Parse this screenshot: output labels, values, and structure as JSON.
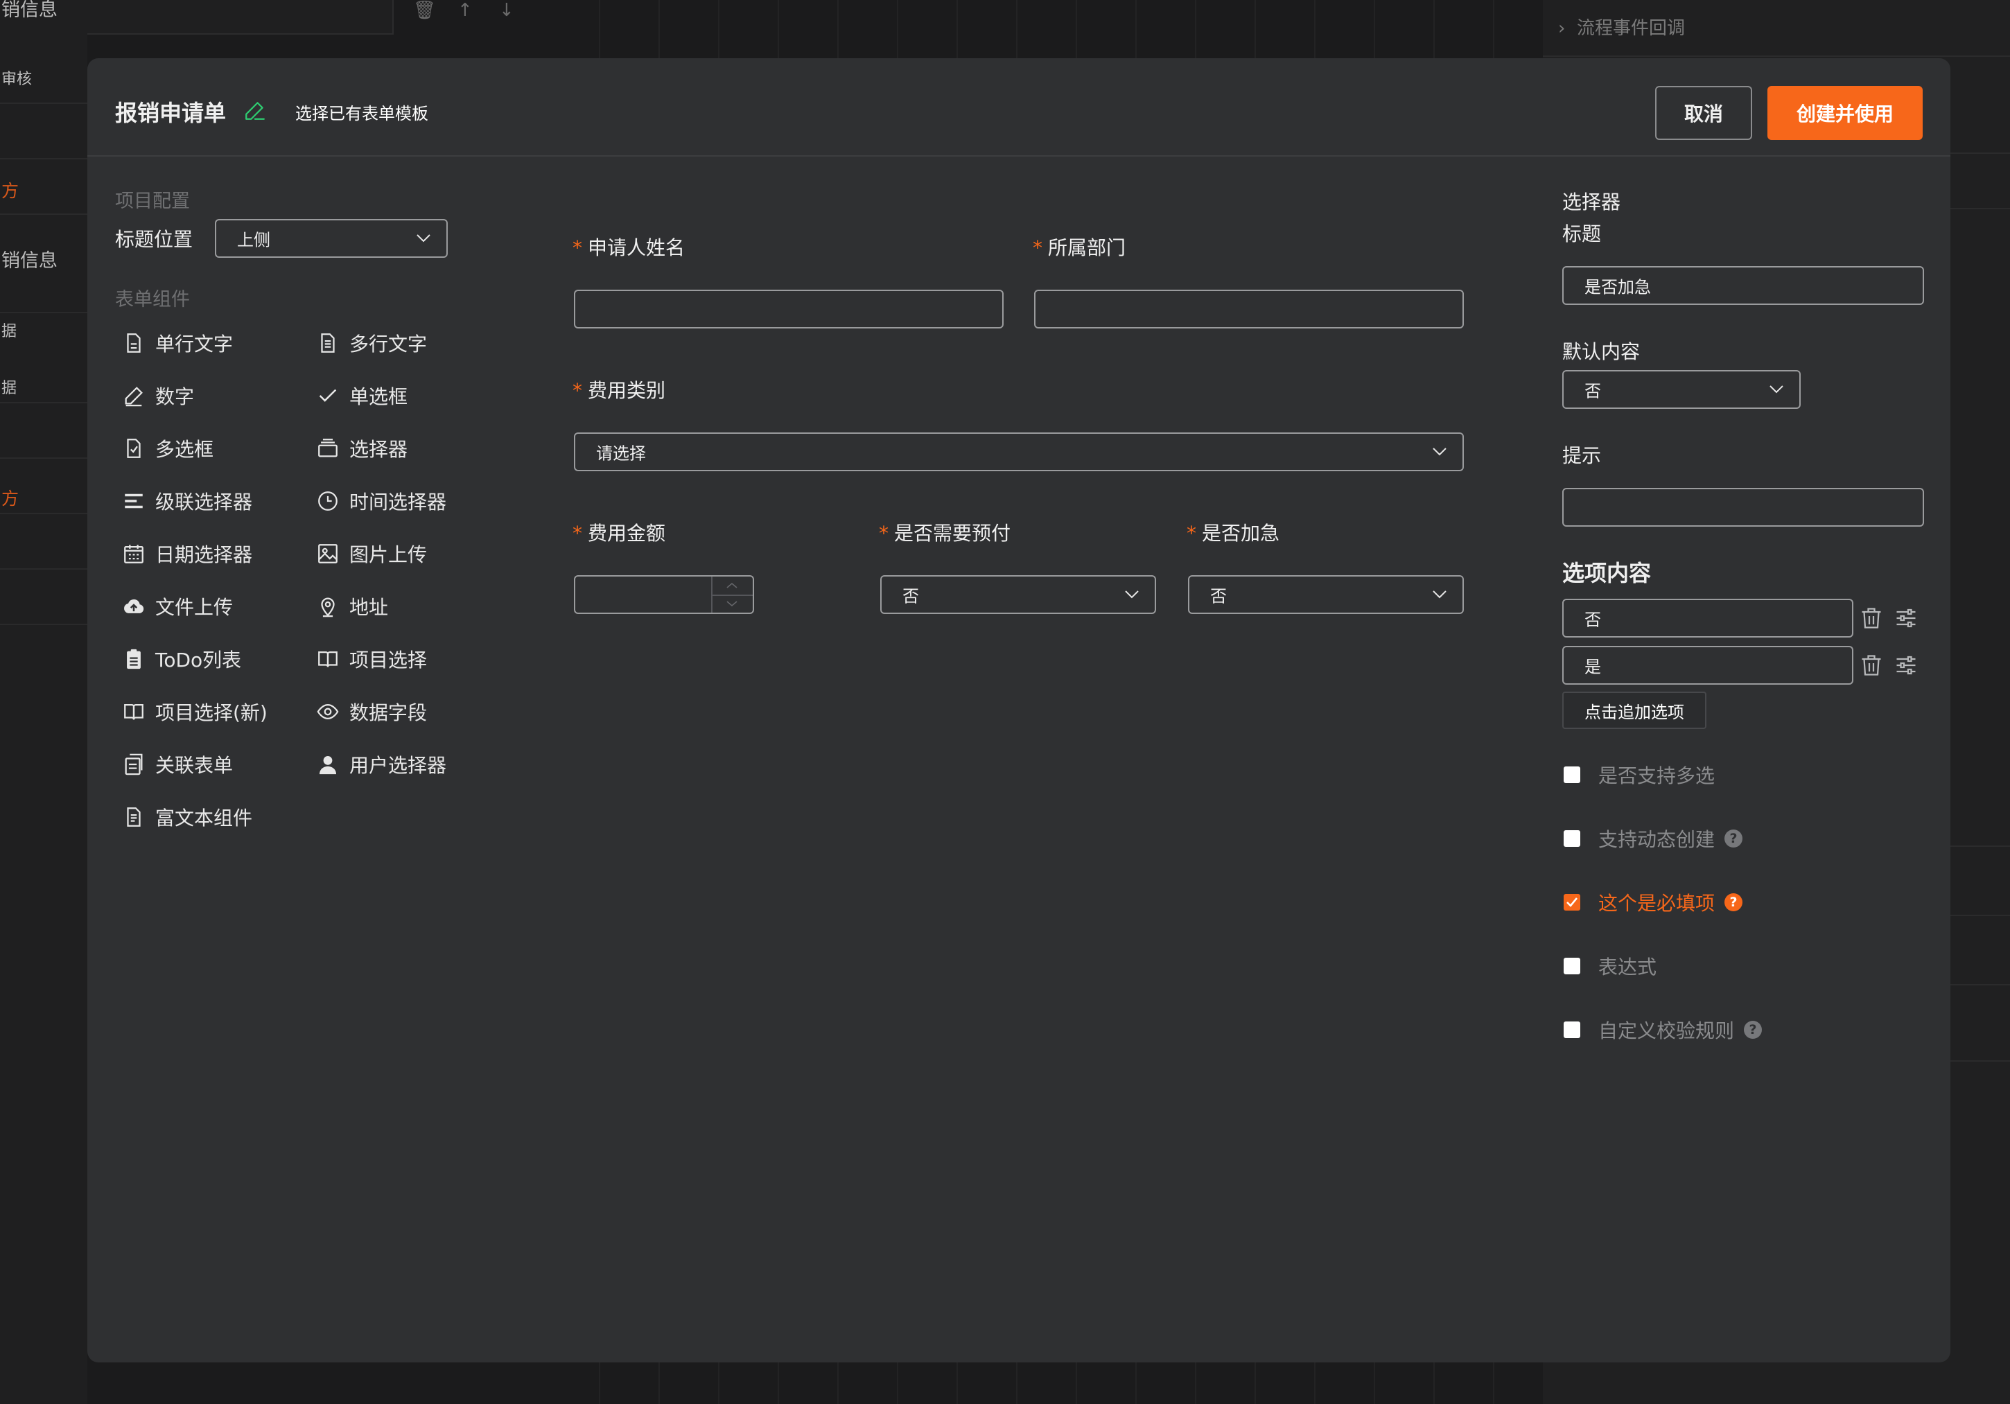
{
  "background": {
    "left_items": [
      "销信息",
      "审核",
      "方",
      "销信息",
      "据",
      "据",
      "方"
    ],
    "right_title": "流程事件回调"
  },
  "modal": {
    "title": "报销申请单",
    "template_link": "选择已有表单模板",
    "cancel_label": "取消",
    "create_label": "创建并使用"
  },
  "palette": {
    "config_section": "项目配置",
    "title_position_label": "标题位置",
    "title_position_value": "上侧",
    "components_section": "表单组件",
    "components": [
      {
        "label": "单行文字",
        "icon": "file-text-icon"
      },
      {
        "label": "多行文字",
        "icon": "file-lines-icon"
      },
      {
        "label": "数字",
        "icon": "pencil-icon"
      },
      {
        "label": "单选框",
        "icon": "check-icon"
      },
      {
        "label": "多选框",
        "icon": "checkbox-icon"
      },
      {
        "label": "选择器",
        "icon": "layers-icon"
      },
      {
        "label": "级联选择器",
        "icon": "list-icon"
      },
      {
        "label": "时间选择器",
        "icon": "clock-icon"
      },
      {
        "label": "日期选择器",
        "icon": "calendar-icon"
      },
      {
        "label": "图片上传",
        "icon": "image-icon"
      },
      {
        "label": "文件上传",
        "icon": "cloud-upload-icon"
      },
      {
        "label": "地址",
        "icon": "location-icon"
      },
      {
        "label": "ToDo列表",
        "icon": "clipboard-icon"
      },
      {
        "label": "项目选择",
        "icon": "book-icon"
      },
      {
        "label": "项目选择(新)",
        "icon": "book-icon"
      },
      {
        "label": "数据字段",
        "icon": "eye-icon"
      },
      {
        "label": "关联表单",
        "icon": "linked-form-icon"
      },
      {
        "label": "用户选择器",
        "icon": "user-icon"
      },
      {
        "label": "富文本组件",
        "icon": "rich-text-icon"
      }
    ]
  },
  "canvas": {
    "required_mark": "*",
    "applicant_label": "申请人姓名",
    "applicant_value": "",
    "department_label": "所属部门",
    "department_value": "",
    "category_label": "费用类别",
    "category_placeholder": "请选择",
    "amount_label": "费用金额",
    "amount_value": "",
    "prepay_label": "是否需要预付",
    "prepay_value": "否",
    "urgent_label": "是否加急",
    "urgent_value": "否"
  },
  "props": {
    "type_label": "选择器",
    "title_label": "标题",
    "title_value": "是否加急",
    "default_label": "默认内容",
    "default_value": "否",
    "hint_label": "提示",
    "hint_value": "",
    "options_title": "选项内容",
    "options": [
      "否",
      "是"
    ],
    "add_option_label": "点击追加选项",
    "checkboxes": [
      {
        "label": "是否支持多选",
        "checked": false,
        "help": false
      },
      {
        "label": "支持动态创建",
        "checked": false,
        "help": true
      },
      {
        "label": "这个是必填项",
        "checked": true,
        "help": true
      },
      {
        "label": "表达式",
        "checked": false,
        "help": false
      },
      {
        "label": "自定义校验规则",
        "checked": false,
        "help": true
      }
    ],
    "help_glyph": "?"
  },
  "colors": {
    "accent": "#f7671a",
    "panel": "#2f3032",
    "edit_icon": "#2ecc71"
  }
}
